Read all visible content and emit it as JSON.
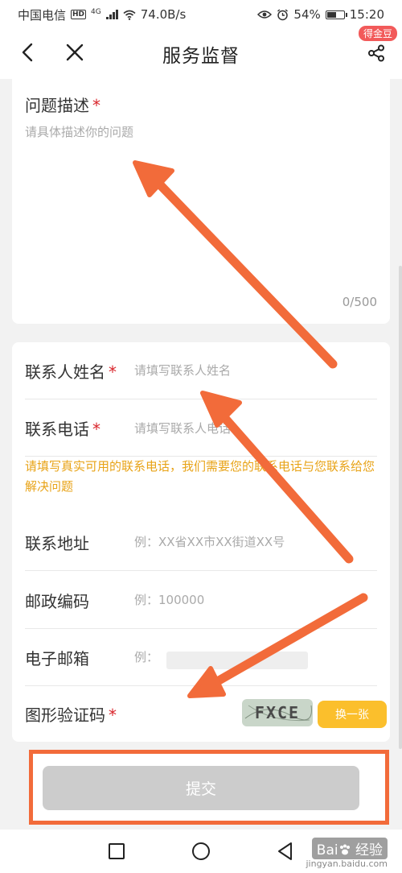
{
  "status_bar": {
    "carrier": "中国电信",
    "hd_badge": "HD",
    "network_type": "4G",
    "speed": "74.0B/s",
    "battery": "54%",
    "battery_level": 0.54,
    "time": "15:20",
    "icons": [
      "eye-icon",
      "alarm-icon",
      "battery-icon"
    ]
  },
  "nav": {
    "title": "服务监督",
    "gold_badge": "得金豆",
    "icons": [
      "back-icon",
      "close-icon",
      "share-icon"
    ]
  },
  "form": {
    "description": {
      "label": "问题描述",
      "required_mark": "*",
      "placeholder": "请具体描述你的问题",
      "counter": "0/500"
    },
    "contact_name": {
      "label": "联系人姓名",
      "required_mark": "*",
      "placeholder": "请填写联系人姓名"
    },
    "contact_phone": {
      "label": "联系电话",
      "required_mark": "*",
      "placeholder": "请填写联系人电话"
    },
    "phone_hint": "请填写真实可用的联系电话，我们需要您的联系电话与您联系给您解决问题",
    "address": {
      "label": "联系地址",
      "placeholder": "例：XX省XX市XX街道XX号"
    },
    "postal_code": {
      "label": "邮政编码",
      "placeholder": "例：100000"
    },
    "email": {
      "label": "电子邮箱",
      "placeholder": "例："
    },
    "captcha": {
      "label": "图形验证码",
      "required_mark": "*",
      "image_text": "FXCE",
      "refresh_label": "换一张"
    },
    "submit_label": "提交"
  },
  "watermark": {
    "brand": "Bai",
    "suffix": "经验",
    "sub": "jingyan.baidu.com"
  },
  "colors": {
    "accent_arrow": "#f26b3a",
    "required": "#d9262c",
    "hint": "#e8a317",
    "refresh_button": "#fbbf2c",
    "submit_disabled": "#cccccc"
  }
}
